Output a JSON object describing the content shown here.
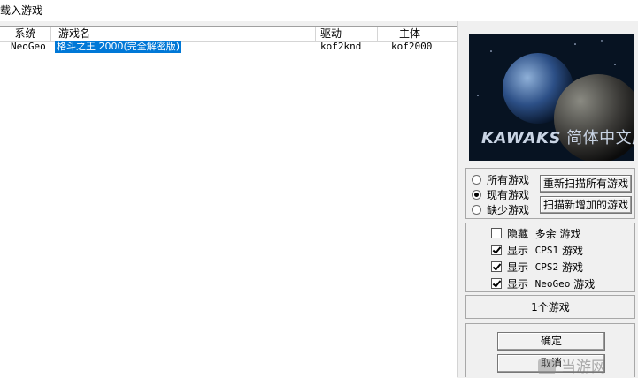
{
  "window": {
    "title": "载入游戏"
  },
  "list": {
    "columns": [
      "系统",
      "游戏名",
      "驱动",
      "主体"
    ],
    "rows": [
      {
        "system": "NeoGeo",
        "name": "格斗之王 2000(完全解密版)",
        "driver": "kof2knd",
        "parent": "kof2000",
        "selected": true
      }
    ]
  },
  "banner": {
    "en": "KAWAKS",
    "cn": "简体中文版"
  },
  "filters": {
    "radio": [
      {
        "label": "所有游戏",
        "checked": false
      },
      {
        "label": "现有游戏",
        "checked": true
      },
      {
        "label": "缺少游戏",
        "checked": false
      }
    ],
    "rescan_all": "重新扫描所有游戏",
    "scan_new": "扫描新增加的游戏"
  },
  "options": [
    {
      "label_a": "隐藏",
      "label_b": "多余",
      "label_c": "游戏",
      "checked": false
    },
    {
      "label_a": "显示",
      "label_b": "CPS1",
      "label_c": "游戏",
      "checked": true
    },
    {
      "label_a": "显示",
      "label_b": "CPS2",
      "label_c": "游戏",
      "checked": true
    },
    {
      "label_a": "显示",
      "label_b": "NeoGeo",
      "label_c": "游戏",
      "checked": true
    }
  ],
  "status": {
    "count_text": "1个游戏"
  },
  "actions": {
    "ok": "确定",
    "cancel": "取消"
  },
  "watermark": {
    "text": "当游网"
  }
}
